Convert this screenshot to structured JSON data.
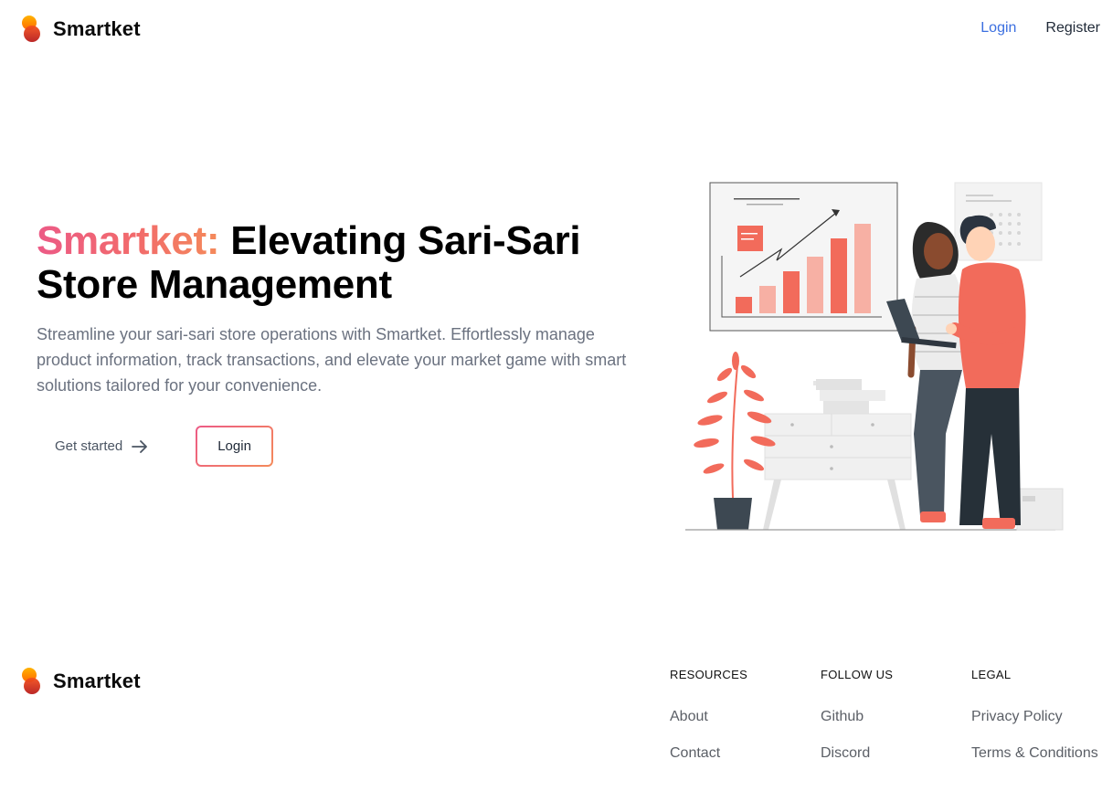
{
  "brand": {
    "name": "Smartket",
    "logo_icon": "smartket-logo-icon"
  },
  "nav": {
    "login": "Login",
    "register": "Register",
    "active_color": "#3b6fe0"
  },
  "hero": {
    "title_accent": "Smartket:",
    "title_rest": " Elevating Sari-Sari Store Management",
    "description": "Streamline your sari-sari store operations with Smartket. Effortlessly manage product information, track transactions, and elevate your market game with smart solutions tailored for your convenience.",
    "get_started": "Get started",
    "get_started_icon": "arrow-right-icon",
    "login": "Login",
    "illustration": "business-illustration"
  },
  "footer": {
    "brand": "Smartket",
    "columns": [
      {
        "title": "RESOURCES",
        "links": [
          "About",
          "Contact"
        ]
      },
      {
        "title": "FOLLOW US",
        "links": [
          "Github",
          "Discord"
        ]
      },
      {
        "title": "LEGAL",
        "links": [
          "Privacy Policy",
          "Terms & Conditions"
        ]
      }
    ]
  },
  "colors": {
    "accent_start": "#ec5a86",
    "accent_end": "#f48a5a",
    "illustration_coral": "#f26b5b"
  }
}
